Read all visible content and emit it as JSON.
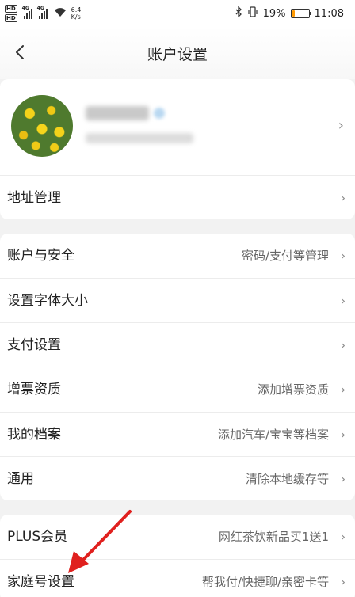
{
  "status_bar": {
    "hd1": "HD",
    "hd2": "HD",
    "sig1_tag": "4G",
    "sig2_tag": "4G",
    "speed_value": "6.4",
    "speed_unit": "K/s",
    "battery_text": "19%",
    "battery_level": 0.19,
    "battery_color": "#ff9900",
    "time": "11:08"
  },
  "header": {
    "title": "账户设置",
    "back_icon": "chevron-left-icon"
  },
  "profile": {
    "chevron": "›"
  },
  "address": {
    "label": "地址管理",
    "chevron": "›"
  },
  "group2": [
    {
      "label": "账户与安全",
      "value": "密码/支付等管理",
      "chevron": "›"
    },
    {
      "label": "设置字体大小",
      "value": "",
      "chevron": "›"
    },
    {
      "label": "支付设置",
      "value": "",
      "chevron": "›"
    },
    {
      "label": "增票资质",
      "value": "添加增票资质",
      "chevron": "›"
    },
    {
      "label": "我的档案",
      "value": "添加汽车/宝宝等档案",
      "chevron": "›"
    },
    {
      "label": "通用",
      "value": "清除本地缓存等",
      "chevron": "›"
    }
  ],
  "group3": [
    {
      "label": "PLUS会员",
      "value": "网红茶饮新品买1送1",
      "chevron": "›"
    },
    {
      "label": "家庭号设置",
      "value": "帮我付/快捷聊/亲密卡等",
      "chevron": "›"
    }
  ],
  "annotation_color": "#e0201e"
}
